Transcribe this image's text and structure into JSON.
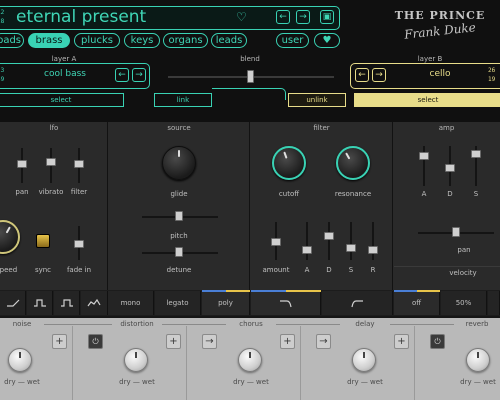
{
  "header": {
    "counter_top": "12",
    "counter_bottom": "28",
    "preset_name": "eternal present",
    "prev_icon": "chevron-left-icon",
    "next_icon": "chevron-right-icon",
    "save_icon": "save-icon",
    "prev_symbol": "←",
    "next_symbol": "→",
    "save_symbol": "▣",
    "heart_symbol": "♡",
    "heart_filled_symbol": "♥",
    "accent": "#39d2b4",
    "accent_b": "#e8dd8a"
  },
  "categories": [
    {
      "label": "pads",
      "active": false
    },
    {
      "label": "brass",
      "active": true
    },
    {
      "label": "plucks",
      "active": false
    },
    {
      "label": "keys",
      "active": false
    },
    {
      "label": "organs",
      "active": false
    },
    {
      "label": "leads",
      "active": false
    },
    {
      "label": "user",
      "active": false
    }
  ],
  "logo": {
    "line1": "THE PRINCE",
    "line2": "Frank Duke"
  },
  "layerA": {
    "title": "layer A",
    "counter_top": "23",
    "counter_bottom": "39",
    "name": "cool bass",
    "select_label": "select",
    "link_label": "link"
  },
  "blend": {
    "title": "blend",
    "value": 0.5
  },
  "layerB": {
    "title": "layer B",
    "counter_top": "26",
    "counter_bottom": "19",
    "name": "cello",
    "unlink_label": "unlink",
    "select_label": "select"
  },
  "panels": {
    "lfo": {
      "title": "lfo",
      "sliders": [
        "pan",
        "vibrato",
        "filter"
      ],
      "knob_label": "speed",
      "sync_label": "sync",
      "fade_label": "fade in"
    },
    "source": {
      "title": "source",
      "glide": "glide",
      "pitch": "pitch",
      "detune": "detune"
    },
    "filter": {
      "title": "filter",
      "cutoff": "cutoff",
      "resonance": "resonance",
      "amount": "amount",
      "adsr": [
        "A",
        "D",
        "S",
        "R"
      ]
    },
    "amp": {
      "title": "amp",
      "ads": [
        "A",
        "D",
        "S"
      ],
      "pan": "pan",
      "velocity": "velocity"
    }
  },
  "modes": {
    "mono": "mono",
    "legato": "legato",
    "poly": "poly",
    "off": "off",
    "percent": "50%"
  },
  "effects": [
    {
      "title": "noise",
      "dry_wet": "dry — wet"
    },
    {
      "title": "distortion",
      "dry_wet": "dry — wet"
    },
    {
      "title": "chorus",
      "dry_wet": "dry — wet"
    },
    {
      "title": "delay",
      "dry_wet": "dry — wet"
    },
    {
      "title": "reverb",
      "dry_wet": "dry — wet"
    }
  ],
  "fx_symbols": {
    "plus": "+",
    "power": "⏻",
    "arrow": "→"
  }
}
